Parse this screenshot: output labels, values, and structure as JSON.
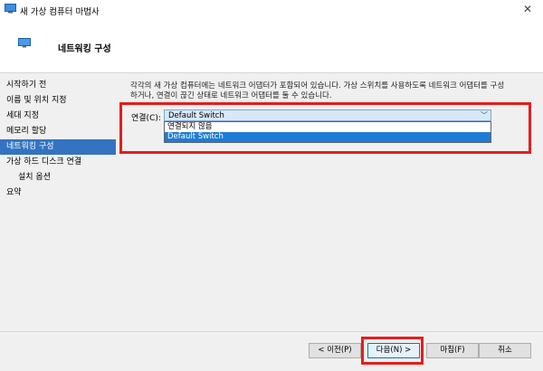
{
  "window": {
    "title": "새 가상 컴퓨터 마법사"
  },
  "header": {
    "title": "네트워킹 구성"
  },
  "sidebar": {
    "items": [
      {
        "label": "시작하기 전"
      },
      {
        "label": "이름 및 위치 지정"
      },
      {
        "label": "세대 지정"
      },
      {
        "label": "메모리 할당"
      },
      {
        "label": "네트워킹 구성"
      },
      {
        "label": "가상 하드 디스크 연결"
      },
      {
        "label": "설치 옵션"
      },
      {
        "label": "요약"
      }
    ],
    "active": "네트워킹 구성"
  },
  "main": {
    "description_line1": "각각의 새 가상 컴퓨터에는 네트워크 어댑터가 포함되어 있습니다. 가상 스위치를 사용하도록 네트워크 어댑터를 구성",
    "description_line2": "하거나, 연결이 끊긴 상태로 네트워크 어댑터를 둘 수 있습니다.",
    "connection_label": "연결(C):",
    "connection_value": "Default Switch",
    "dropdown_options": [
      "연결되지 않음",
      "Default Switch"
    ],
    "selected_option": "Default Switch"
  },
  "buttons": {
    "previous": "< 이전(P)",
    "next": "다음(N) >",
    "finish": "마침(F)",
    "cancel": "취소"
  },
  "colors": {
    "accent": "#3373c1",
    "highlight": "#e81c1c",
    "selection": "#1e7cd6"
  },
  "icons": [
    "app-icon",
    "network-icon",
    "close-icon",
    "chevron-down-icon"
  ]
}
